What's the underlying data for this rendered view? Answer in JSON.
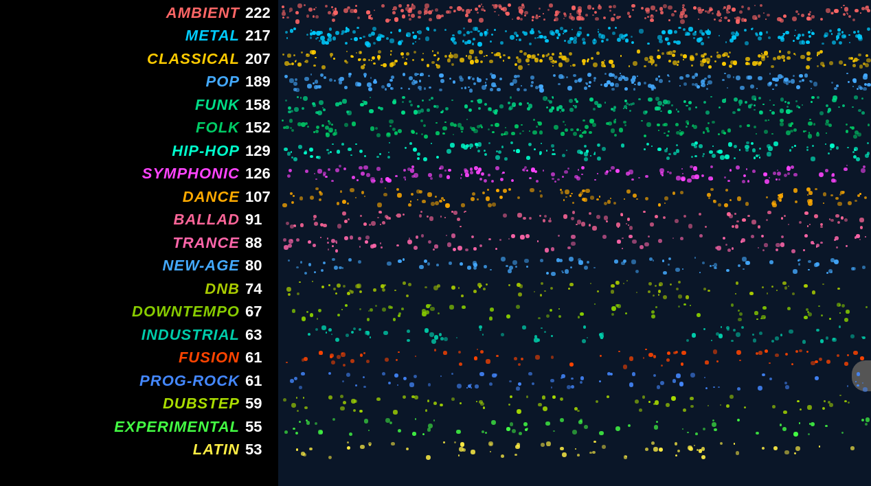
{
  "genres": [
    {
      "label": "AMBIENT",
      "count": 222,
      "color": "#ff6666",
      "dotColor": "#ff6666"
    },
    {
      "label": "METAL",
      "count": 217,
      "color": "#00ccff",
      "dotColor": "#00ccff"
    },
    {
      "label": "CLASSICAL",
      "count": 207,
      "color": "#ffcc00",
      "dotColor": "#ffcc00"
    },
    {
      "label": "POP",
      "count": 189,
      "color": "#44aaff",
      "dotColor": "#44aaff"
    },
    {
      "label": "FUNK",
      "count": 158,
      "color": "#00dd88",
      "dotColor": "#00dd88"
    },
    {
      "label": "FOLK",
      "count": 152,
      "color": "#00cc66",
      "dotColor": "#00cc66"
    },
    {
      "label": "HIP-HOP",
      "count": 129,
      "color": "#00ffcc",
      "dotColor": "#00ffcc"
    },
    {
      "label": "SYMPHONIC",
      "count": 126,
      "color": "#ff44ff",
      "dotColor": "#ff44ff"
    },
    {
      "label": "DANCE",
      "count": 107,
      "color": "#ffaa00",
      "dotColor": "#ffaa00"
    },
    {
      "label": "BALLAD",
      "count": 91,
      "color": "#ff6699",
      "dotColor": "#ff6699"
    },
    {
      "label": "TRANCE",
      "count": 88,
      "color": "#ff66aa",
      "dotColor": "#ff66aa"
    },
    {
      "label": "NEW-AGE",
      "count": 80,
      "color": "#44aaff",
      "dotColor": "#44aaff"
    },
    {
      "label": "DNB",
      "count": 74,
      "color": "#aacc00",
      "dotColor": "#aacc00"
    },
    {
      "label": "DOWNTEMPO",
      "count": 67,
      "color": "#88cc00",
      "dotColor": "#88cc00"
    },
    {
      "label": "INDUSTRIAL",
      "count": 63,
      "color": "#00ccaa",
      "dotColor": "#00ccaa"
    },
    {
      "label": "FUSION",
      "count": 61,
      "color": "#ff4400",
      "dotColor": "#ff4400"
    },
    {
      "label": "PROG-ROCK",
      "count": 61,
      "color": "#4488ff",
      "dotColor": "#4488ff"
    },
    {
      "label": "DUBSTEP",
      "count": 59,
      "color": "#aadd00",
      "dotColor": "#aadd00"
    },
    {
      "label": "EXPERIMENTAL",
      "count": 55,
      "color": "#44ff44",
      "dotColor": "#44ff44"
    },
    {
      "label": "LATIN",
      "count": 53,
      "color": "#ffee44",
      "dotColor": "#ffee44"
    }
  ],
  "viz": {
    "bg": "#0a1628"
  }
}
